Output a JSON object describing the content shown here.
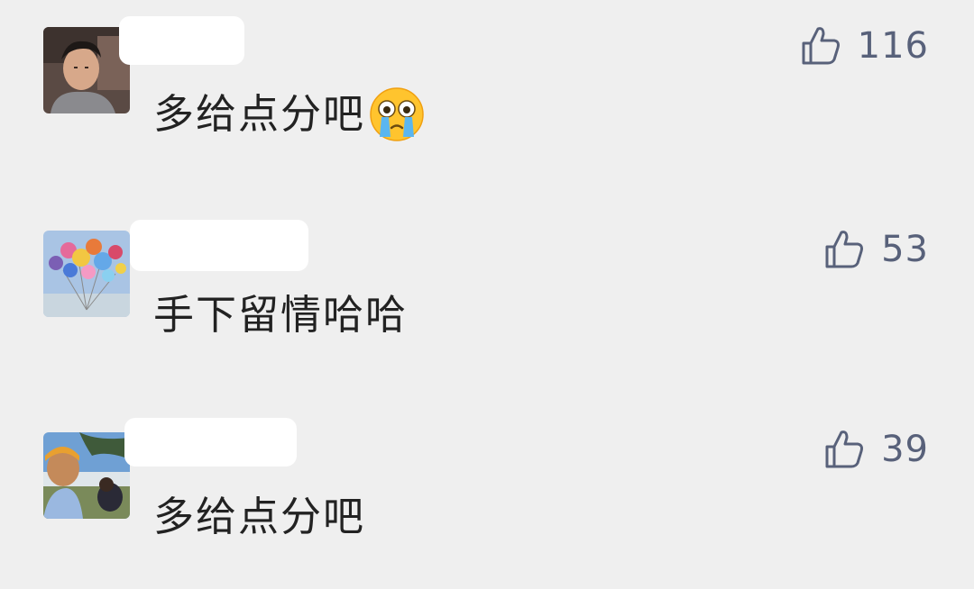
{
  "comments": [
    {
      "text": "多给点分吧",
      "emoji": "crying-face-emoji",
      "likes": "116",
      "icon": "thumbs-up-icon"
    },
    {
      "text": "手下留情哈哈",
      "likes": "53",
      "icon": "thumbs-up-icon"
    },
    {
      "text": "多给点分吧",
      "likes": "39",
      "icon": "thumbs-up-icon"
    }
  ],
  "colors": {
    "background": "#efefef",
    "like": "#58617a",
    "text": "#222222",
    "mask": "#ffffff"
  }
}
